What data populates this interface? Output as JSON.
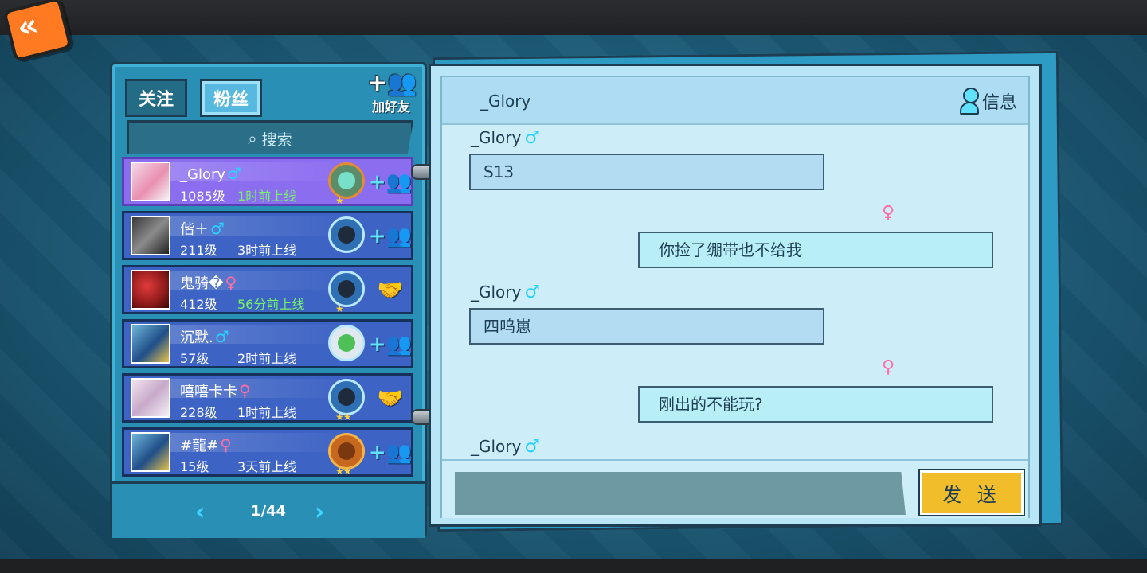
{
  "left_panel": {
    "tabs": {
      "follow": "关注",
      "fans": "粉丝"
    },
    "add_friend_label": "加好友",
    "search_placeholder": "搜索",
    "friends": [
      {
        "name": "_Glory",
        "gender": "♂",
        "level": "1085级",
        "online": "1时前上线",
        "action": "add"
      },
      {
        "name": "偕＋",
        "gender": "♂",
        "level": "211级",
        "online": "3时前上线",
        "action": "add"
      },
      {
        "name": "鬼骑�",
        "gender": "♀",
        "level": "412级",
        "online": "56分前上线",
        "action": "handshake"
      },
      {
        "name": "沉默.",
        "gender": "♂",
        "level": "57级",
        "online": "2时前上线",
        "action": "add"
      },
      {
        "name": "嘻嘻卡卡",
        "gender": "♀",
        "level": "228级",
        "online": "1时前上线",
        "action": "handshake"
      },
      {
        "name": "#龍#",
        "gender": "♀",
        "level": "15级",
        "online": "3天前上线",
        "action": "add"
      }
    ],
    "pager": {
      "prev": "‹",
      "page": "1/44",
      "next": "›"
    }
  },
  "chat": {
    "title": "_Glory",
    "info_label": "信息",
    "messages": [
      {
        "from": "other",
        "sender": "_Glory",
        "gender": "♂",
        "text": "S13"
      },
      {
        "from": "self",
        "gender": "♀",
        "text": "你捡了绷带也不给我"
      },
      {
        "from": "other",
        "sender": "_Glory",
        "gender": "♂",
        "text": "四呜崽"
      },
      {
        "from": "self",
        "gender": "♀",
        "text": "刚出的不能玩?"
      },
      {
        "from": "other",
        "sender": "_Glory",
        "gender": "♂",
        "text": ""
      }
    ],
    "input_value": "",
    "send_label": "发 送"
  },
  "colors": {
    "male": "#29d1ff",
    "female": "#ff6fa5",
    "online_recent": "#76f26a",
    "selected_row": "#8b6ef0",
    "row": "#3d63c4",
    "send_button": "#f1bd2b"
  }
}
